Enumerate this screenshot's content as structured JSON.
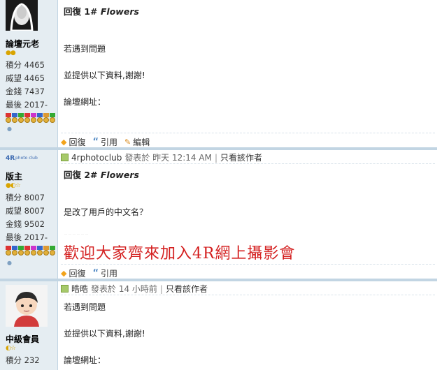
{
  "posts": [
    {
      "user": {
        "name": "論壇元老",
        "stats": [
          "積分 4465",
          "威望 4465",
          "金錢 7437",
          "最後 2017-"
        ]
      },
      "title_prefix": "回復 ",
      "title_num": "1#",
      "title_name": "Flowers",
      "lines": [
        "若遇到問題",
        "並提供以下資料,謝謝!",
        "論壇網址："
      ],
      "actions": {
        "reply": "回復",
        "quote": "引用",
        "edit": "編輯"
      }
    },
    {
      "user": {
        "name": "版主",
        "avatar_text": "4Rphoto club",
        "stats": [
          "積分 8007",
          "威望 8007",
          "金錢 9502",
          "最後 2017-"
        ]
      },
      "meta": {
        "author": "4rphotoclub",
        "posted": "發表於 昨天 12:14 AM",
        "sep": "|",
        "only": "只看該作者"
      },
      "title_prefix": "回復 ",
      "title_num": "2#",
      "title_name": "Flowers",
      "lines": [
        "是改了用戶的中文名？"
      ],
      "banner": "歡迎大家齊來加入4R網上攝影會",
      "actions": {
        "reply": "回復",
        "quote": "引用"
      }
    },
    {
      "user": {
        "name": "中級會員",
        "stats": [
          "積分 232"
        ]
      },
      "meta": {
        "author": "晧晧",
        "posted": "發表於 14 小時前",
        "sep": "|",
        "only": "只看該作者"
      },
      "lines": [
        "若遇到問題",
        "並提供以下資料,謝謝!",
        "論壇網址："
      ]
    }
  ],
  "colors": {
    "sidebar": "#e5edf2",
    "separator": "#c2d5e3",
    "banner": "#d42020"
  }
}
